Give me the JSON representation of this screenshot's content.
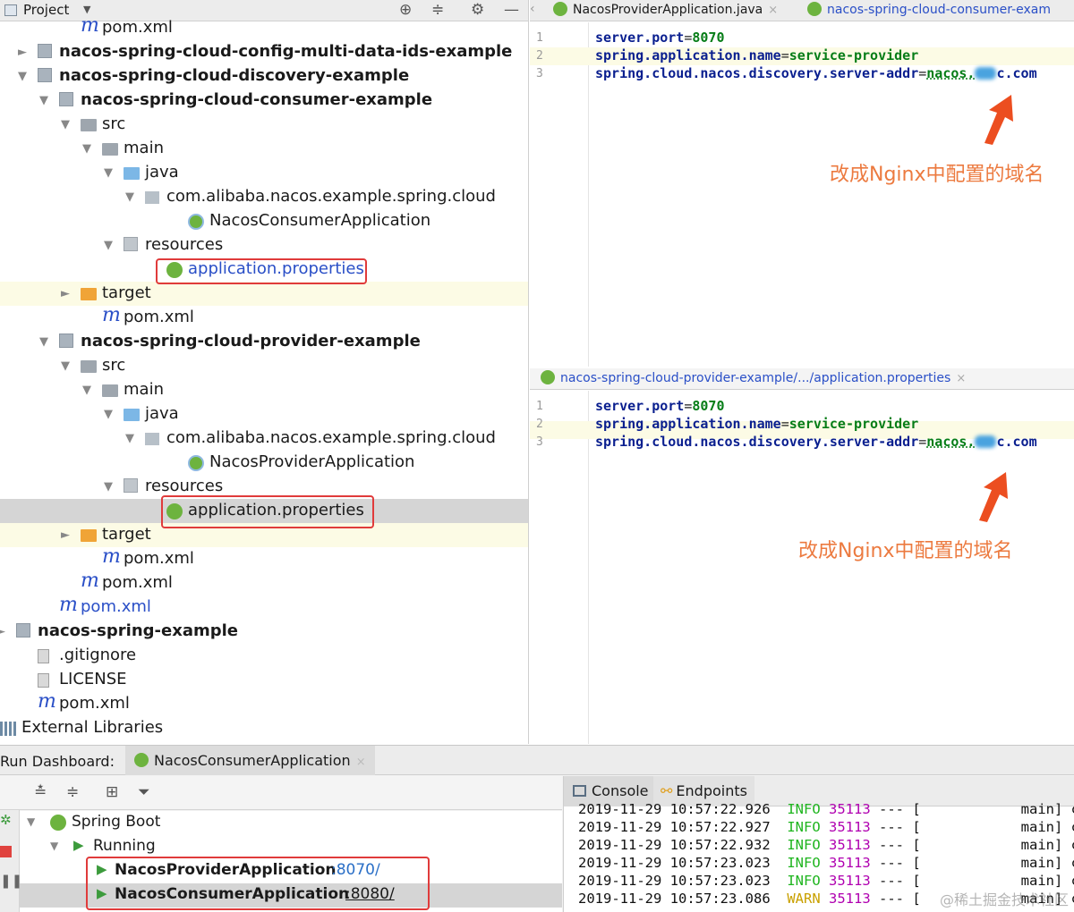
{
  "project": {
    "header_title": "Project",
    "tree": [
      {
        "label": "pom.xml",
        "icon": "maven-icon",
        "bold": false,
        "blue": false
      },
      {
        "label": "nacos-spring-cloud-config-multi-data-ids-example",
        "icon": "module-folder-icon",
        "bold": true
      },
      {
        "label": "nacos-spring-cloud-discovery-example",
        "icon": "module-folder-icon",
        "bold": true
      },
      {
        "label": "nacos-spring-cloud-consumer-example",
        "icon": "module-folder-icon",
        "bold": true
      },
      {
        "label": "src",
        "icon": "folder-icon"
      },
      {
        "label": "main",
        "icon": "folder-icon"
      },
      {
        "label": "java",
        "icon": "source-folder-icon"
      },
      {
        "label": "com.alibaba.nacos.example.spring.cloud",
        "icon": "package-icon"
      },
      {
        "label": "NacosConsumerApplication",
        "icon": "spring-boot-class-icon"
      },
      {
        "label": "resources",
        "icon": "resources-folder-icon"
      },
      {
        "label": "application.properties",
        "icon": "spring-properties-icon"
      },
      {
        "label": "target",
        "icon": "target-folder-icon"
      },
      {
        "label": "pom.xml",
        "icon": "maven-icon"
      },
      {
        "label": "nacos-spring-cloud-provider-example",
        "icon": "module-folder-icon",
        "bold": true
      },
      {
        "label": "src",
        "icon": "folder-icon"
      },
      {
        "label": "main",
        "icon": "folder-icon"
      },
      {
        "label": "java",
        "icon": "source-folder-icon"
      },
      {
        "label": "com.alibaba.nacos.example.spring.cloud",
        "icon": "package-icon"
      },
      {
        "label": "NacosProviderApplication",
        "icon": "spring-boot-class-icon"
      },
      {
        "label": "resources",
        "icon": "resources-folder-icon"
      },
      {
        "label": "application.properties",
        "icon": "spring-properties-icon"
      },
      {
        "label": "target",
        "icon": "target-folder-icon"
      },
      {
        "label": "pom.xml",
        "icon": "maven-icon"
      },
      {
        "label": "pom.xml",
        "icon": "maven-icon"
      },
      {
        "label": "pom.xml",
        "icon": "maven-icon"
      },
      {
        "label": "nacos-spring-example",
        "icon": "module-folder-icon",
        "bold": true
      },
      {
        "label": ".gitignore",
        "icon": "file-icon"
      },
      {
        "label": "LICENSE",
        "icon": "file-icon"
      },
      {
        "label": "pom.xml",
        "icon": "maven-icon"
      },
      {
        "label": "External Libraries",
        "icon": "library-icon"
      }
    ]
  },
  "editor_top": {
    "tabs": [
      "NacosProviderApplication.java",
      "nacos-spring-cloud-consumer-exam"
    ],
    "lines": [
      {
        "num": "1",
        "key": "server.port",
        "value": "8070"
      },
      {
        "num": "2",
        "key": "spring.application.name",
        "value": "service-provider"
      },
      {
        "num": "3",
        "key": "spring.cloud.nacos.discovery.server-addr",
        "value_prefix": "nacos.",
        "value_suffix": "c.com"
      }
    ],
    "note": "改成Nginx中配置的域名"
  },
  "editor_bottom": {
    "tab": "nacos-spring-cloud-provider-example/.../application.properties",
    "lines": [
      {
        "num": "1",
        "key": "server.port",
        "value": "8070"
      },
      {
        "num": "2",
        "key": "spring.application.name",
        "value": "service-provider"
      },
      {
        "num": "3",
        "key": "spring.cloud.nacos.discovery.server-addr",
        "value_prefix": "nacos.",
        "value_suffix": "c.com"
      }
    ],
    "note": "改成Nginx中配置的域名"
  },
  "dashboard": {
    "title": "Run Dashboard:",
    "tab": "NacosConsumerApplication",
    "tree": {
      "spring_boot": "Spring Boot",
      "running": "Running",
      "apps": [
        {
          "name": "NacosProviderApplication",
          "port": ":8070/"
        },
        {
          "name": "NacosConsumerApplication",
          "port": ":8080/"
        }
      ]
    },
    "console_tabs": [
      "Console",
      "Endpoints"
    ],
    "logs": [
      {
        "date": "2019-11-29",
        "time": "10:57:22.926",
        "level": "INFO",
        "pid": "35113",
        "sep": "---",
        "thread": "main"
      },
      {
        "date": "2019-11-29",
        "time": "10:57:22.927",
        "level": "INFO",
        "pid": "35113",
        "sep": "---",
        "thread": "main"
      },
      {
        "date": "2019-11-29",
        "time": "10:57:22.932",
        "level": "INFO",
        "pid": "35113",
        "sep": "---",
        "thread": "main"
      },
      {
        "date": "2019-11-29",
        "time": "10:57:23.023",
        "level": "INFO",
        "pid": "35113",
        "sep": "---",
        "thread": "main"
      },
      {
        "date": "2019-11-29",
        "time": "10:57:23.023",
        "level": "INFO",
        "pid": "35113",
        "sep": "---",
        "thread": "main"
      },
      {
        "date": "2019-11-29",
        "time": "10:57:23.086",
        "level": "WARN",
        "pid": "35113",
        "sep": "---",
        "thread": "main"
      }
    ],
    "watermark": "@稀土掘金技术社区"
  },
  "colors": {
    "annotation": "#ec7a3f",
    "highlight_box": "#e03b3b",
    "key": "#0a1f8f",
    "value": "#067d17"
  }
}
